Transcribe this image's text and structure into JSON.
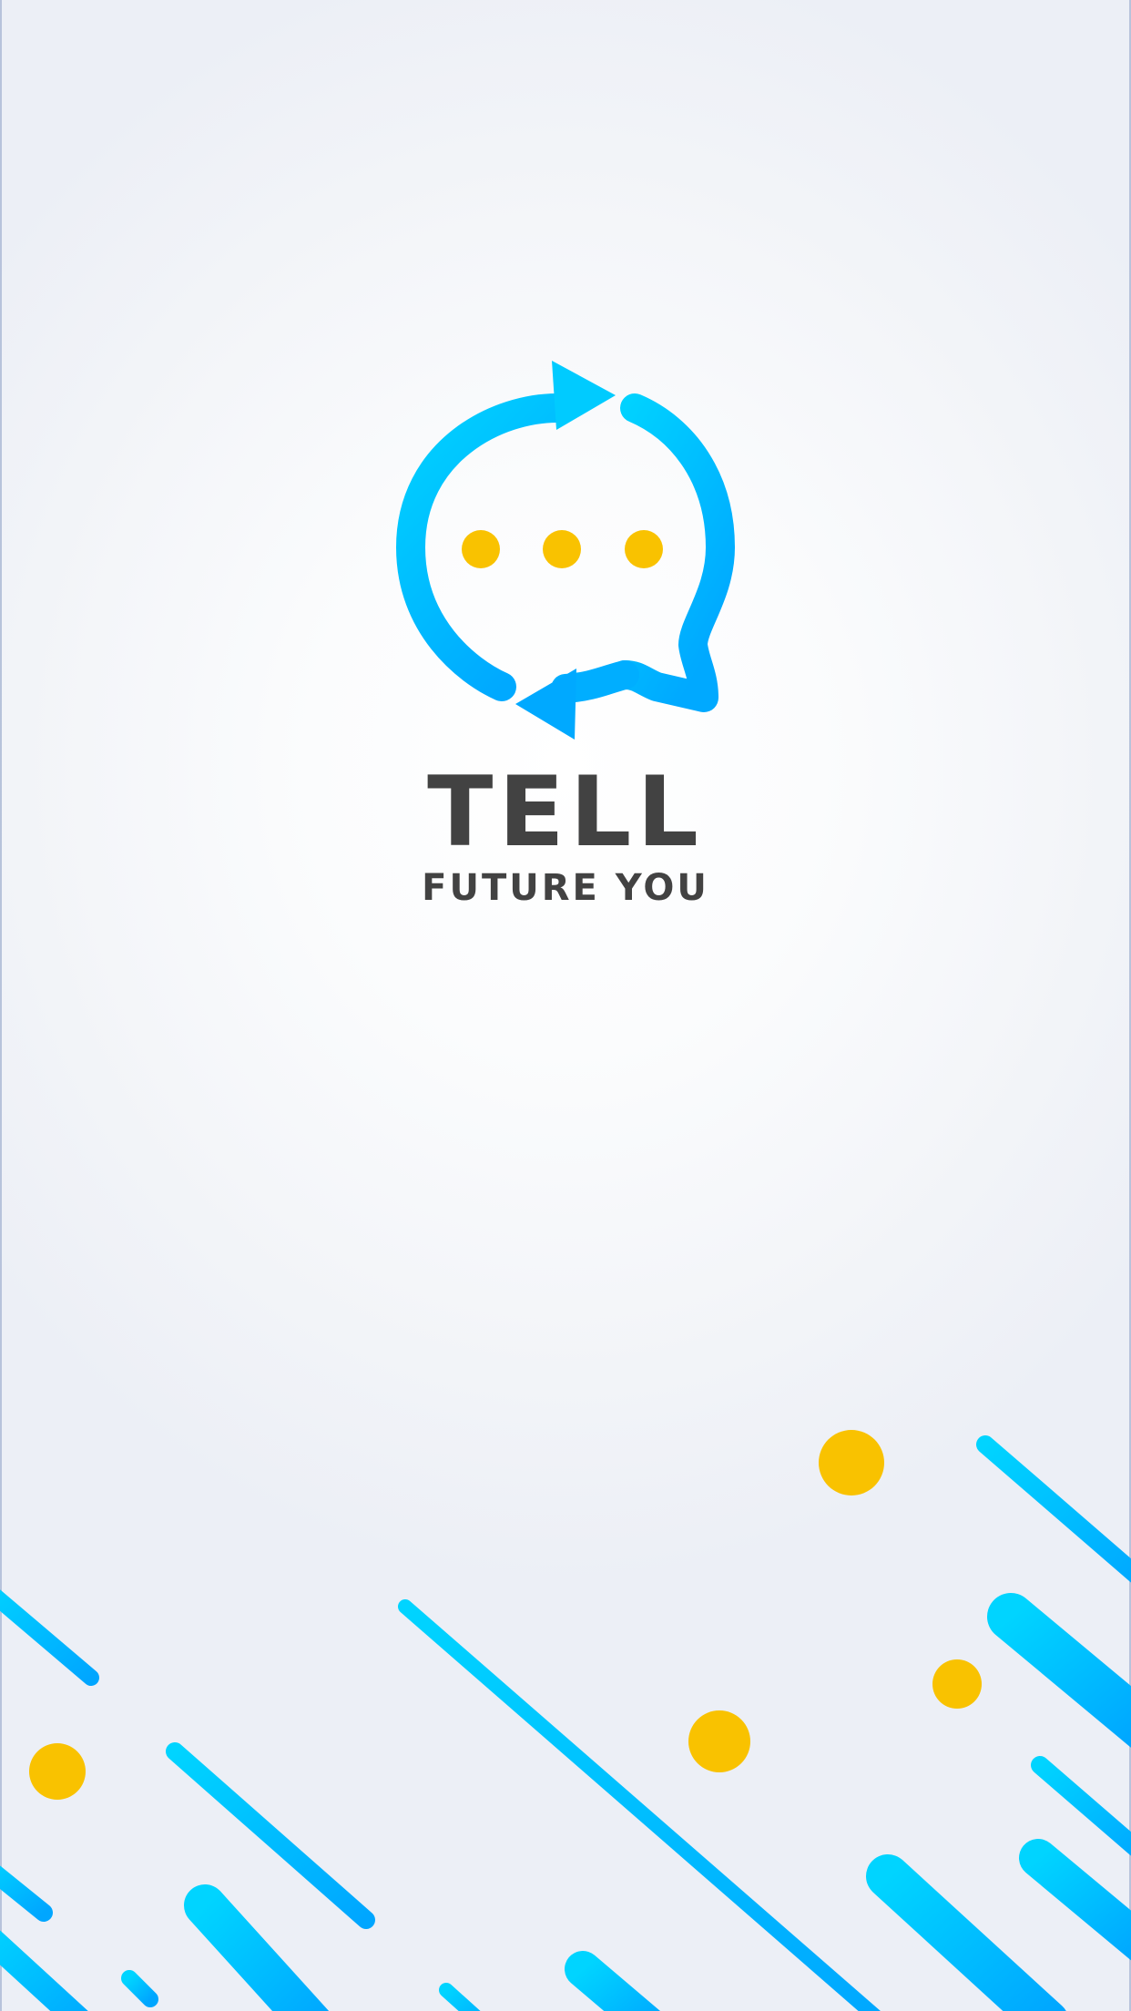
{
  "splash": {
    "brand_title": "TELL",
    "brand_subtitle": "FUTURE YOU"
  },
  "logo": {
    "icon": "chat-bubble-refresh-icon",
    "dots_count": 3
  },
  "colors": {
    "background": "#f2f4f8",
    "brand_blue_light": "#00d2ff",
    "brand_blue": "#00a9ff",
    "brand_yellow": "#f9c200",
    "text_dark": "#424242"
  }
}
